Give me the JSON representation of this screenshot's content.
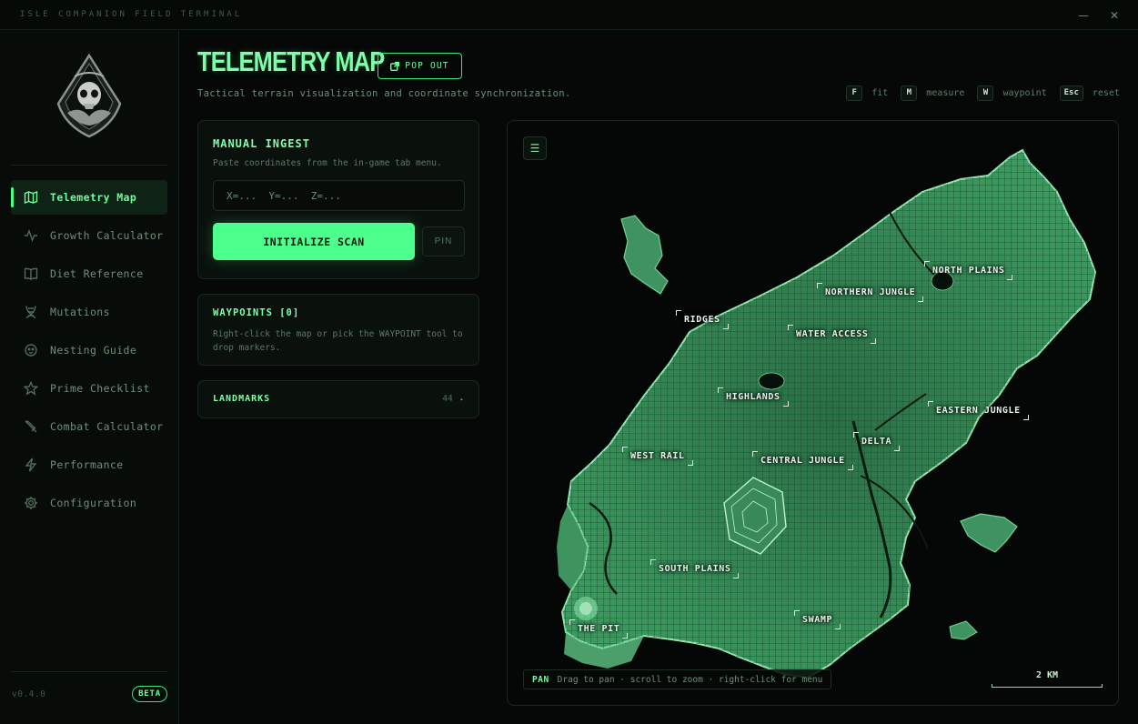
{
  "window": {
    "title": "ISLE COMPANION FIELD TERMINAL",
    "minimize": "—",
    "close": "✕"
  },
  "sidebar": {
    "items": [
      {
        "label": "Telemetry Map",
        "icon": "map-icon",
        "active": true
      },
      {
        "label": "Growth Calculator",
        "icon": "activity-icon",
        "active": false
      },
      {
        "label": "Diet Reference",
        "icon": "book-icon",
        "active": false
      },
      {
        "label": "Mutations",
        "icon": "dna-icon",
        "active": false
      },
      {
        "label": "Nesting Guide",
        "icon": "egg-icon",
        "active": false
      },
      {
        "label": "Prime Checklist",
        "icon": "star-icon",
        "active": false
      },
      {
        "label": "Combat Calculator",
        "icon": "swords-icon",
        "active": false
      },
      {
        "label": "Performance",
        "icon": "bolt-icon",
        "active": false
      },
      {
        "label": "Configuration",
        "icon": "gear-icon",
        "active": false
      }
    ],
    "version": "v0.4.0",
    "badge": "BETA"
  },
  "header": {
    "title": "TELEMETRY MAP",
    "popout_label": "POP OUT",
    "subtitle": "Tactical terrain visualization and coordinate synchronization.",
    "shortcuts": [
      {
        "key": "F",
        "label": "fit"
      },
      {
        "key": "M",
        "label": "measure"
      },
      {
        "key": "W",
        "label": "waypoint"
      },
      {
        "key": "Esc",
        "label": "reset"
      }
    ]
  },
  "ingest": {
    "title": "MANUAL INGEST",
    "description": "Paste coordinates from the in-game tab menu.",
    "placeholder": "X=...  Y=...  Z=...",
    "value": "",
    "scan_label": "INITIALIZE SCAN",
    "pin_label": "PIN"
  },
  "waypoints": {
    "title": "WAYPOINTS [0]",
    "description": "Right-click the map or pick the WAYPOINT tool to drop markers."
  },
  "landmarks": {
    "title": "LANDMARKS",
    "count": "44",
    "caret": "▸"
  },
  "map": {
    "menu_glyph": "☰",
    "labels": [
      "NORTH PLAINS",
      "NORTHERN JUNGLE",
      "RIDGES",
      "WATER ACCESS",
      "HIGHLANDS",
      "EASTERN JUNGLE",
      "DELTA",
      "WEST RAIL",
      "CENTRAL JUNGLE",
      "SOUTH PLAINS",
      "SWAMP",
      "THE PIT"
    ],
    "hint_mode": "PAN",
    "hint_text": "Drag to pan · scroll to zoom · right-click for menu",
    "scale_label": "2 KM",
    "colors": {
      "land": "#2e7a4c",
      "land_light": "#4ea86e",
      "coast": "#8fe7ad",
      "water": "#040705"
    }
  },
  "theme": {
    "accent": "#4dff8c",
    "accent_text": "#7dffaa",
    "background": "#050806",
    "panel": "#0a110c"
  }
}
